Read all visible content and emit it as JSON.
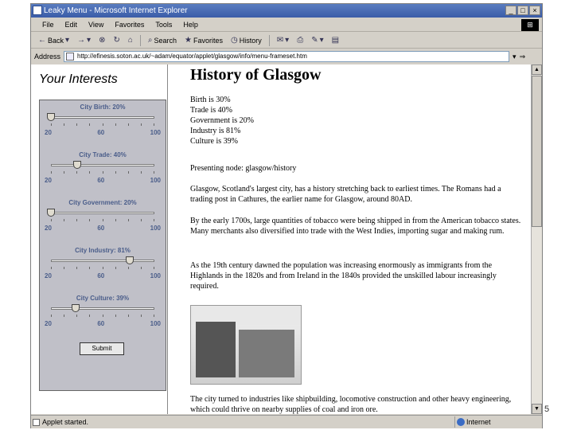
{
  "window": {
    "title": "Leaky Menu - Microsoft Internet Explorer",
    "buttons": [
      "_",
      "□",
      "×"
    ]
  },
  "menubar": [
    "File",
    "Edit",
    "View",
    "Favorites",
    "Tools",
    "Help"
  ],
  "toolbar": {
    "back": "Back",
    "search": "Search",
    "favorites": "Favorites",
    "history": "History"
  },
  "address": {
    "label": "Address",
    "url": "http://efinesis.soton.ac.uk/~adam/equator/applet/glasgow/info/menu-frameset.htm"
  },
  "left": {
    "heading": "Your Interests",
    "sliders": [
      {
        "label": "City Birth: 20%",
        "value": 20
      },
      {
        "label": "City Trade: 40%",
        "value": 40
      },
      {
        "label": "City Government: 20%",
        "value": 20
      },
      {
        "label": "City Industry: 81%",
        "value": 81
      },
      {
        "label": "City Culture: 39%",
        "value": 39
      }
    ],
    "scale": [
      "20",
      "60",
      "100"
    ],
    "submit": "Submit"
  },
  "page": {
    "title": "History of Glasgow",
    "interests": [
      "Birth is 30%",
      "Trade is 40%",
      "Government is 20%",
      "Industry is 81%",
      "Culture is 39%"
    ],
    "presenting": "Presenting node: glasgow/history",
    "p1": "Glasgow, Scotland's largest city, has a history stretching back to earliest times. The Romans had a trading post in Cathures, the earlier name for Glasgow, around 80AD.",
    "p2": "By the early 1700s, large quantities of tobacco were being shipped in from the American tobacco states. Many merchants also diversified into trade with the West Indies, importing sugar and making rum.",
    "p3": "As the 19th century dawned the population was increasing enormously as immigrants from the Highlands in the 1820s and from Ireland in the 1840s provided the unskilled labour increasingly required.",
    "p4": "The city turned to industries like shipbuilding, locomotive construction and other heavy engineering, which could thrive on nearby supplies of coal and iron ore."
  },
  "status": {
    "text": "Applet started.",
    "zone": "Internet"
  },
  "slide_number": "5"
}
